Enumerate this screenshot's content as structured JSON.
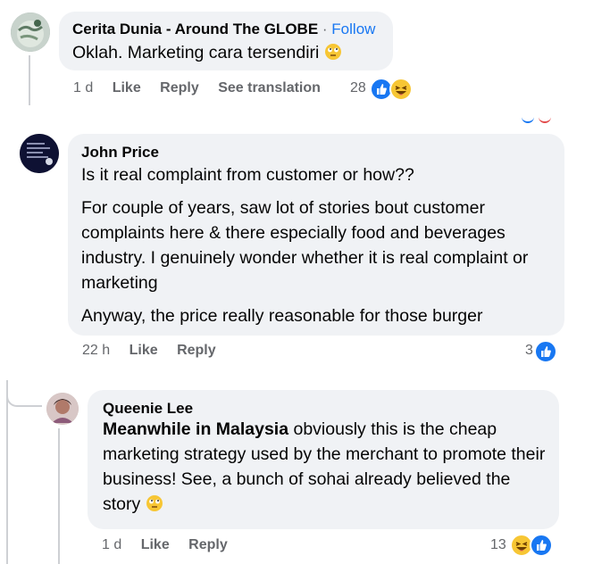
{
  "comments": [
    {
      "author": "Cerita Dunia - Around The GLOBE",
      "separator": "·",
      "follow_label": "Follow",
      "text": "Oklah. Marketing cara tersendiri",
      "time": "1 d",
      "like_label": "Like",
      "reply_label": "Reply",
      "translate_label": "See translation",
      "reaction_count": "28",
      "reactions": [
        "like-icon",
        "haha-icon"
      ]
    },
    {
      "author": "John Price",
      "paragraphs": [
        "Is it real complaint from customer or how??",
        "For couple of years, saw lot of stories bout customer complaints here & there especially food and beverages industry. I genuinely wonder whether it is real complaint or marketing",
        "Anyway, the price really reasonable for those burger"
      ],
      "time": "22 h",
      "like_label": "Like",
      "reply_label": "Reply",
      "reaction_count": "3",
      "reactions": [
        "like-icon"
      ]
    },
    {
      "author": "Queenie Lee",
      "mention": "Meanwhile in Malaysia",
      "text": " obviously this is the cheap marketing strategy used by the merchant to promote their business! See, a bunch of sohai already believed the story",
      "time": "1 d",
      "like_label": "Like",
      "reply_label": "Reply",
      "reaction_count": "13",
      "reactions": [
        "haha-icon",
        "like-icon"
      ]
    }
  ],
  "colors": {
    "bubble": "#f0f2f5",
    "meta": "#65676b",
    "accent": "#1877f2",
    "haha": "#f7c634"
  }
}
